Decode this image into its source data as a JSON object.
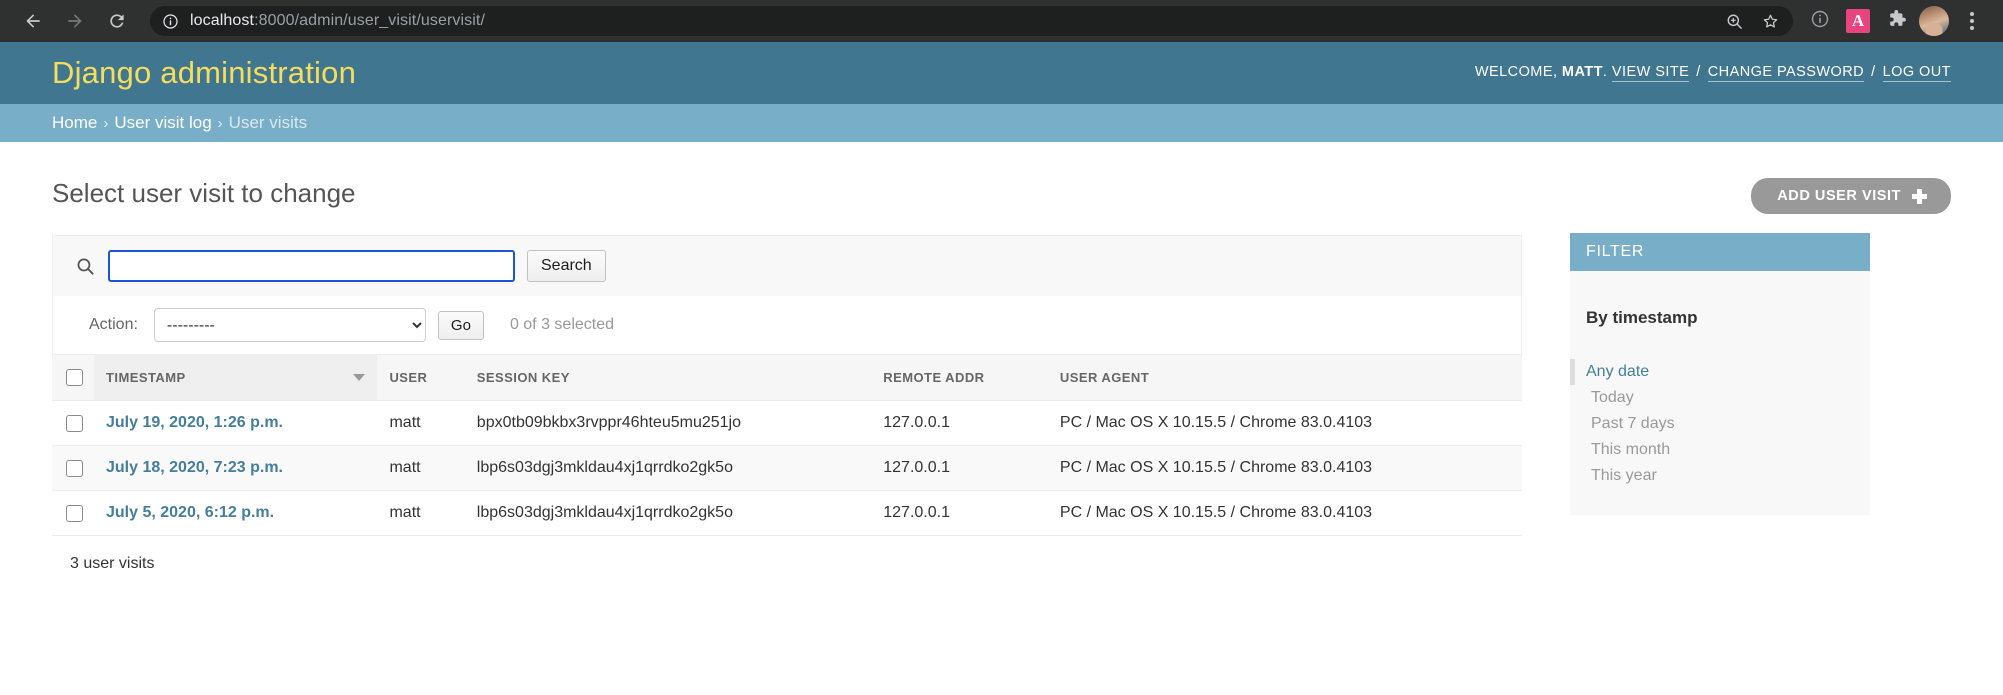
{
  "browser": {
    "back_icon": "arrow-left-icon",
    "forward_icon": "arrow-right-icon",
    "reload_icon": "reload-icon",
    "info_icon": "info-circle-icon",
    "url_host": "localhost",
    "url_rest": ":8000/admin/user_visit/uservisit/",
    "zoom_icon": "zoom-magnifier-icon",
    "bookmark_icon": "star-icon",
    "page_info_icon": "info-circle-icon",
    "extension_badge_label": "A",
    "extensions_icon": "puzzle-piece-icon",
    "profile_icon": "user-avatar",
    "menu_icon": "three-dot-menu-icon"
  },
  "header": {
    "brand": "Django administration",
    "welcome_prefix": "Welcome,",
    "username": "matt",
    "period": ".",
    "links": [
      {
        "label": "View site"
      },
      {
        "label": "Change password"
      },
      {
        "label": "Log out"
      }
    ],
    "separator": "/"
  },
  "breadcrumbs": {
    "items": [
      {
        "label": "Home",
        "current": false
      },
      {
        "label": "User visit log",
        "current": false
      },
      {
        "label": "User visits",
        "current": true
      }
    ],
    "separator": "›"
  },
  "page": {
    "title": "Select user visit to change",
    "add_button_label": "Add user visit",
    "add_button_icon": "plus-icon"
  },
  "search": {
    "icon": "search-magnifier-icon",
    "value": "",
    "placeholder": "",
    "button_label": "Search"
  },
  "actions": {
    "label": "Action:",
    "selected_option": "---------",
    "options": [
      "---------"
    ],
    "go_label": "Go",
    "selection_counter": "0 of 3 selected"
  },
  "table": {
    "select_all_name": "select-all-checkbox",
    "columns": [
      {
        "label": "Timestamp",
        "sorted": true,
        "sort_direction": "descending"
      },
      {
        "label": "User",
        "sorted": false
      },
      {
        "label": "Session key",
        "sorted": false
      },
      {
        "label": "Remote addr",
        "sorted": false
      },
      {
        "label": "User agent",
        "sorted": false
      }
    ],
    "rows": [
      {
        "timestamp": "July 19, 2020, 1:26 p.m.",
        "user": "matt",
        "session_key": "bpx0tb09bkbx3rvppr46hteu5mu251jo",
        "remote_addr": "127.0.0.1",
        "user_agent": "PC / Mac OS X 10.15.5 / Chrome 83.0.4103"
      },
      {
        "timestamp": "July 18, 2020, 7:23 p.m.",
        "user": "matt",
        "session_key": "lbp6s03dgj3mkldau4xj1qrrdko2gk5o",
        "remote_addr": "127.0.0.1",
        "user_agent": "PC / Mac OS X 10.15.5 / Chrome 83.0.4103"
      },
      {
        "timestamp": "July 5, 2020, 6:12 p.m.",
        "user": "matt",
        "session_key": "lbp6s03dgj3mkldau4xj1qrrdko2gk5o",
        "remote_addr": "127.0.0.1",
        "user_agent": "PC / Mac OS X 10.15.5 / Chrome 83.0.4103"
      }
    ],
    "result_count": "3 user visits"
  },
  "filter": {
    "title": "Filter",
    "group_title": "By timestamp",
    "options": [
      {
        "label": "Any date",
        "selected": true
      },
      {
        "label": "Today",
        "selected": false
      },
      {
        "label": "Past 7 days",
        "selected": false
      },
      {
        "label": "This month",
        "selected": false
      },
      {
        "label": "This year",
        "selected": false
      }
    ]
  },
  "colors": {
    "django_header": "#417690",
    "breadcrumb_bar": "#79aec8",
    "brand_yellow": "#f5dd5d",
    "link_blue": "#447e9b",
    "focus_blue": "#1a56d6",
    "add_button_gray": "#999999"
  }
}
